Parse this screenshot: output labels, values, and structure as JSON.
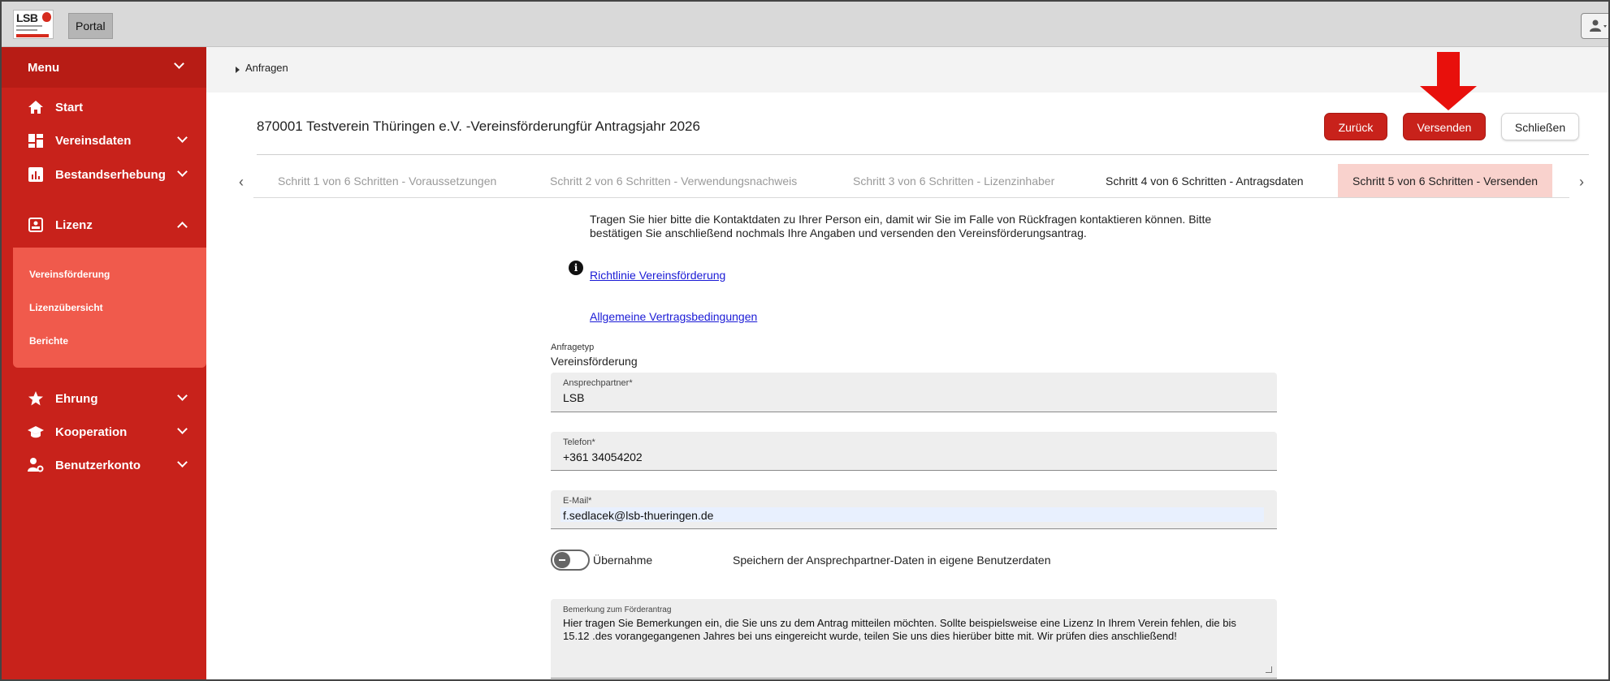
{
  "topbar": {
    "logo_text": "LSB",
    "portal_label": "Portal"
  },
  "sidebar": {
    "menu_label": "Menu",
    "items": [
      {
        "label": "Start",
        "icon": "home-icon"
      },
      {
        "label": "Vereinsdaten",
        "icon": "dashboard-icon"
      },
      {
        "label": "Bestandserhebung",
        "icon": "bar-chart-icon"
      },
      {
        "label": "Lizenz",
        "icon": "badge-icon"
      },
      {
        "label": "Ehrung",
        "icon": "star-icon"
      },
      {
        "label": "Kooperation",
        "icon": "graduation-cap-icon"
      },
      {
        "label": "Benutzerkonto",
        "icon": "user-settings-icon"
      }
    ],
    "lizenz_sub": [
      "Vereinsförderung",
      "Lizenzübersicht",
      "Berichte"
    ]
  },
  "breadcrumb": "Anfragen",
  "header": {
    "title": "870001 Testverein Thüringen e.V. -Vereinsförderungfür Antragsjahr 2026",
    "back_label": "Zurück",
    "send_label": "Versenden",
    "close_label": "Schließen"
  },
  "steps": [
    "Schritt 1 von 6 Schritten - Voraussetzungen",
    "Schritt 2 von 6 Schritten - Verwendungsnachweis",
    "Schritt 3 von 6 Schritten - Lizenzinhaber",
    "Schritt 4 von 6 Schritten - Antragsdaten",
    "Schritt 5 von 6 Schritten - Versenden"
  ],
  "form": {
    "intro_line1": "Tragen Sie hier bitte die Kontaktdaten zu Ihrer Person ein, damit wir Sie im Falle von Rückfragen kontaktieren können. Bitte",
    "intro_line2": "bestätigen Sie anschließend nochmals Ihre Angaben und versenden den Vereinsförderungsantrag.",
    "link_richtlinie": "Richtlinie Vereinsförderung",
    "link_agb": "Allgemeine Vertragsbedingungen",
    "anfragetyp_label": "Anfragetyp",
    "anfragetyp_value": "Vereinsförderung",
    "ansprechpartner_label": "Ansprechpartner*",
    "ansprechpartner_value": "LSB",
    "telefon_label": "Telefon*",
    "telefon_value": "+361 34054202",
    "email_label": "E-Mail*",
    "email_value": "f.sedlacek@lsb-thueringen.de",
    "toggle_label": "Übernahme",
    "toggle_desc": "Speichern der Ansprechpartner-Daten in eigene Benutzerdaten",
    "bemerkung_label": "Bemerkung zum Förderantrag",
    "bemerkung_value": "Hier tragen Sie Bemerkungen ein, die Sie uns zu dem Antrag mitteilen möchten. Sollte beispielsweise eine Lizenz In Ihrem Verein fehlen, die bis 15.12 .des vorangegangenen Jahres bei uns eingereicht wurde, teilen Sie uns dies hierüber bitte mit. Wir prüfen dies anschließend!"
  },
  "colors": {
    "brand_red": "#c8221b",
    "submenu_red": "#f05a4c",
    "active_step_bg": "#f9d2cd",
    "annotation_arrow": "#e8100c"
  }
}
